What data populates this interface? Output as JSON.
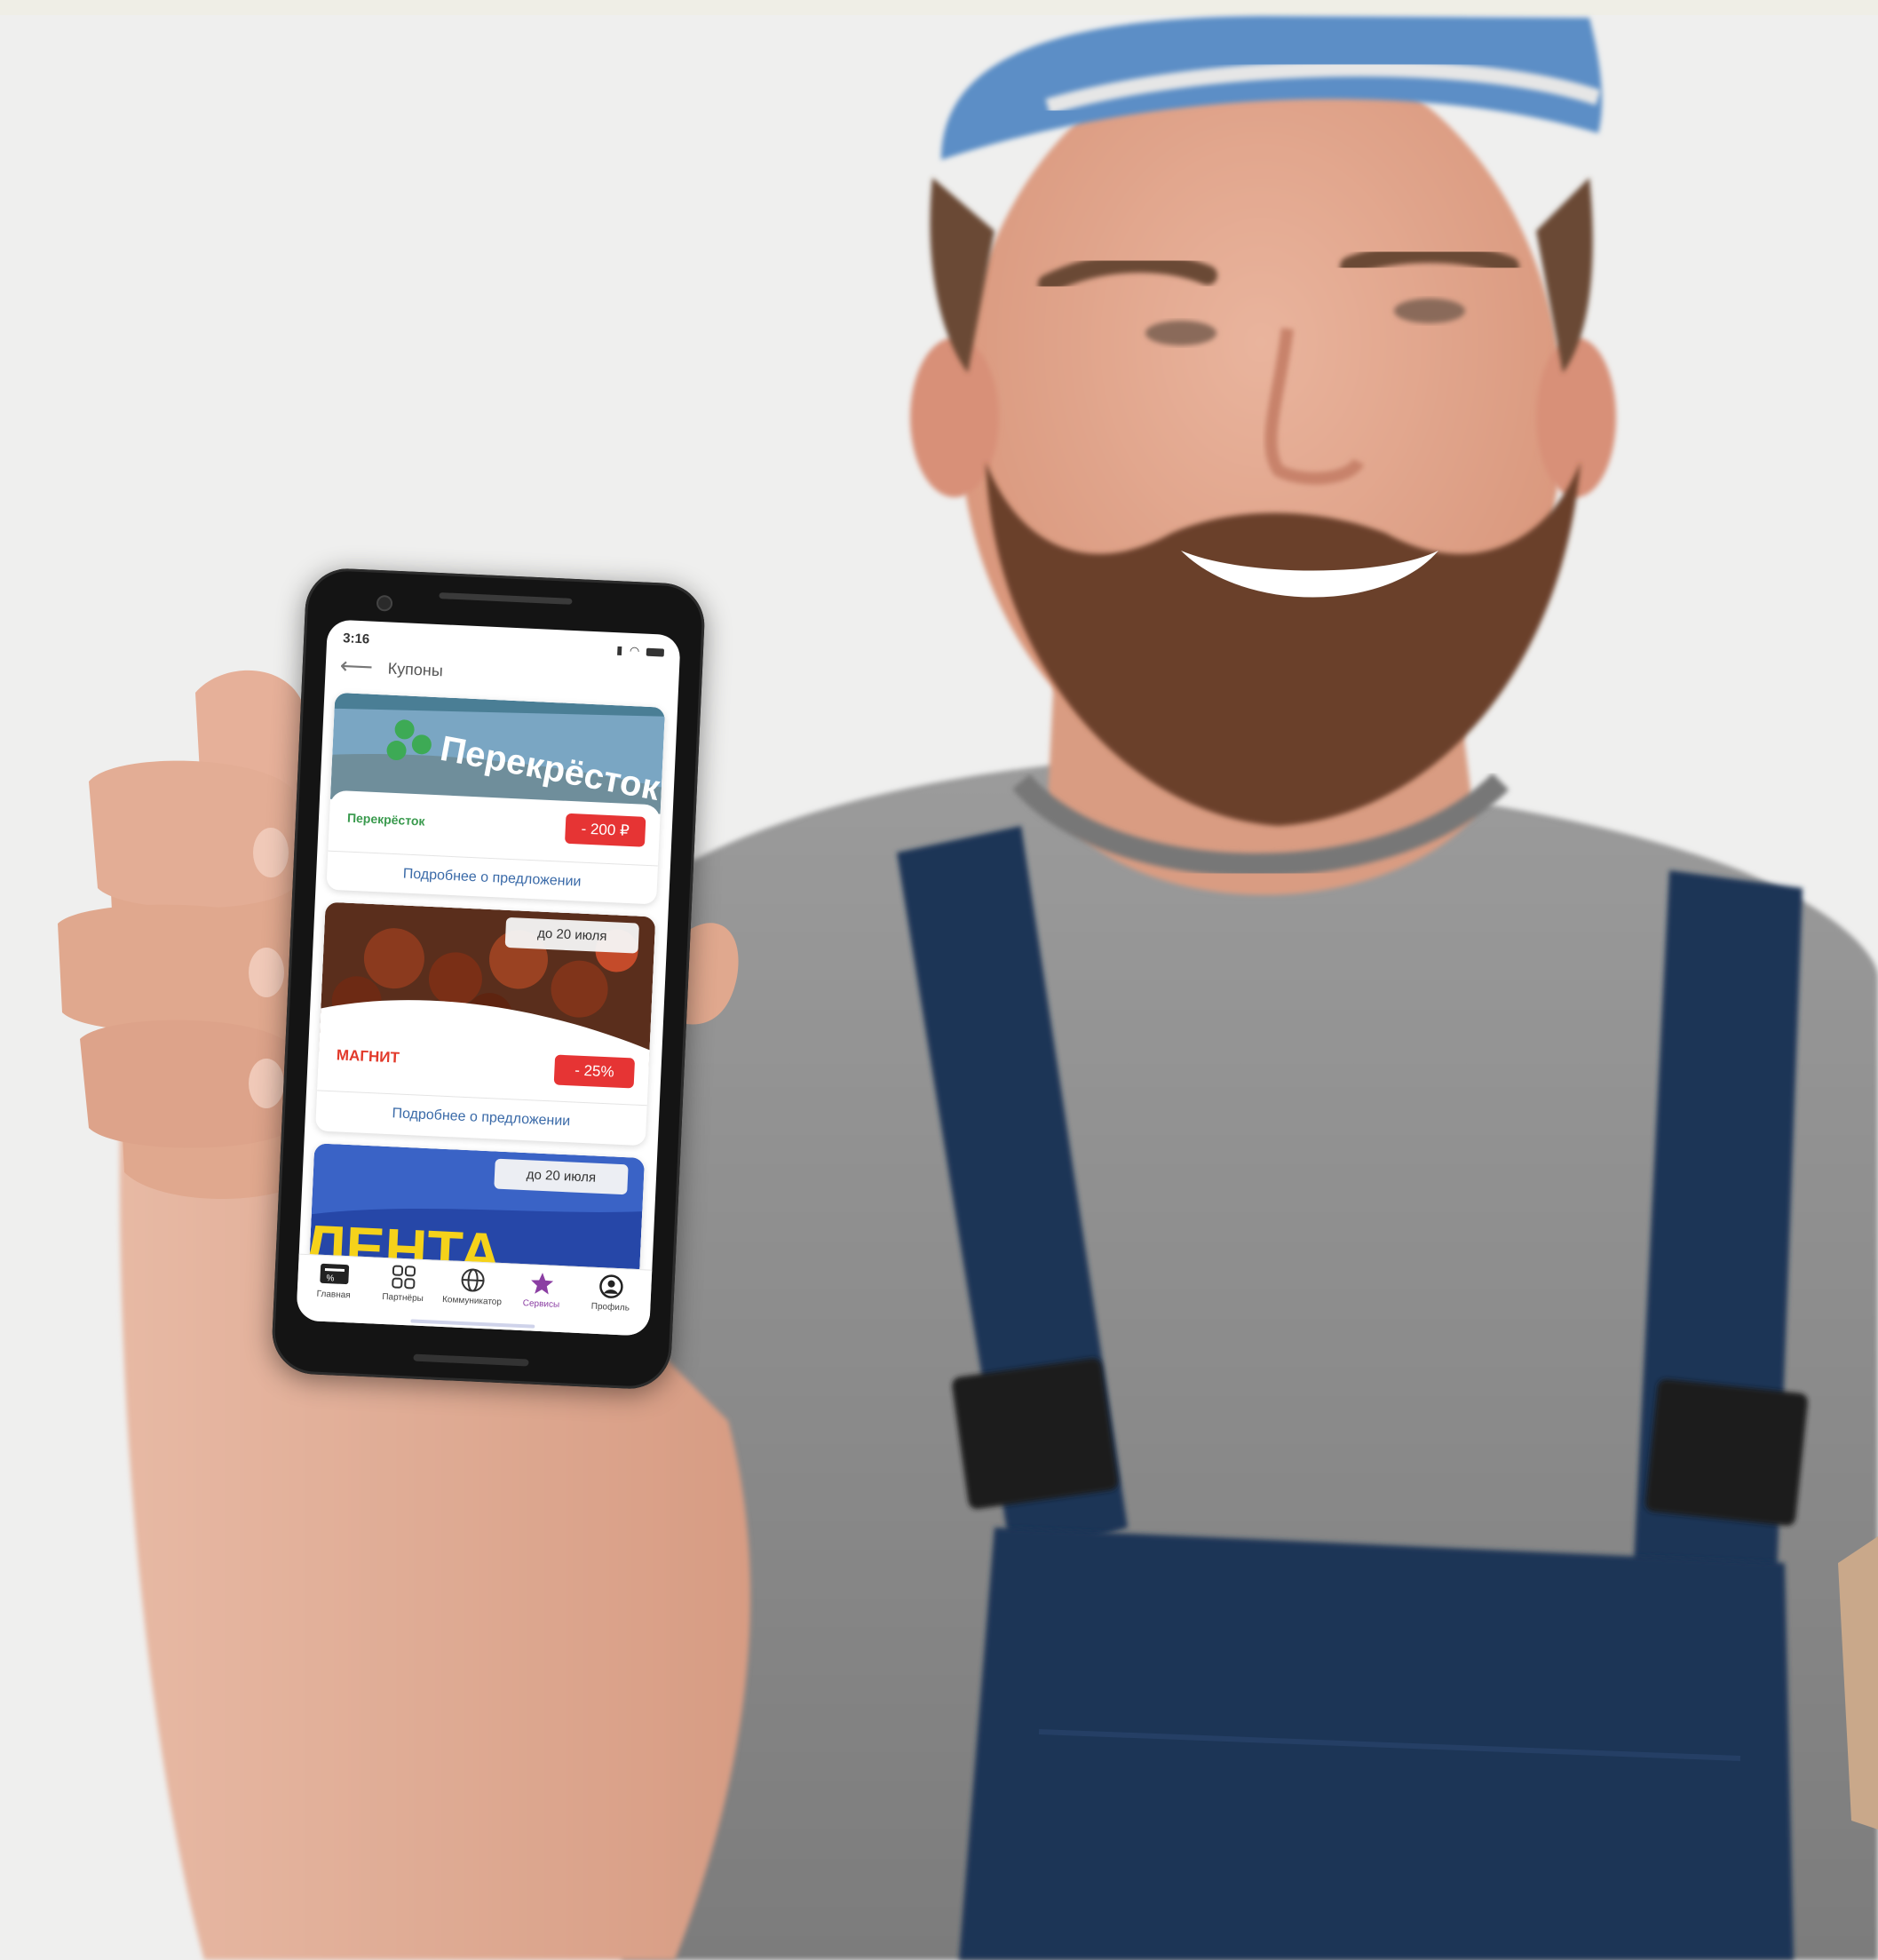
{
  "phone": {
    "status_time": "3:16",
    "header": {
      "title": "Купоны"
    },
    "coupons": [
      {
        "brand": "Перекрёсток",
        "discount": "- 200 ₽",
        "link": "Подробнее о предложении",
        "image_sign": "Перекрёсток"
      },
      {
        "brand": "МАГНИТ",
        "discount": "- 25%",
        "date": "до 20 июля",
        "link": "Подробнее о предложении"
      },
      {
        "date": "до 20 июля",
        "image_sign": "ЛЕНТА"
      }
    ],
    "tabs": [
      {
        "label": "Главная",
        "icon": "coupon-icon"
      },
      {
        "label": "Партнёры",
        "icon": "grid-icon"
      },
      {
        "label": "Коммуникатор",
        "icon": "globe-icon"
      },
      {
        "label": "Сервисы",
        "icon": "star-icon"
      },
      {
        "label": "Профиль",
        "icon": "profile-icon"
      }
    ],
    "active_tab": "Сервисы"
  },
  "colors": {
    "background": "#efefee",
    "discount_badge": "#e63434",
    "link": "#3a6aa8",
    "active_tab": "#8b3ea3",
    "cap": "#5b8ec6",
    "overalls": "#1f3556",
    "tshirt": "#8a8a8a"
  }
}
